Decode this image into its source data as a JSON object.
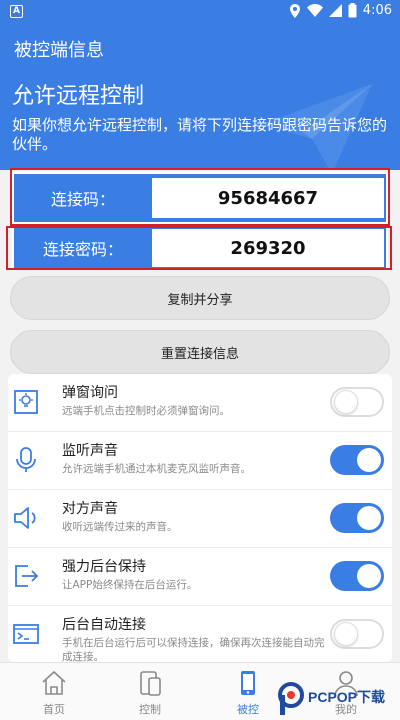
{
  "status_bar": {
    "time": "4:06",
    "left_icon": "A"
  },
  "header": {
    "title": "被控端信息",
    "heading": "允许远程控制",
    "description": "如果你想允许远程控制，请将下列连接码跟密码告诉您的伙伴。"
  },
  "connection": {
    "code_label": "连接码：",
    "code_value": "95684667",
    "password_label": "连接密码：",
    "password_value": "269320"
  },
  "buttons": {
    "copy_share": "复制并分享",
    "reset": "重置连接信息"
  },
  "settings": [
    {
      "title": "弹窗询问",
      "desc": "远端手机点击控制时必须弹窗询问。",
      "on": false,
      "icon": "lamp-icon"
    },
    {
      "title": "监听声音",
      "desc": "允许远端手机通过本机麦克风监听声音。",
      "on": true,
      "icon": "microphone-icon"
    },
    {
      "title": "对方声音",
      "desc": "收听远端传过来的声音。",
      "on": true,
      "icon": "speaker-icon"
    },
    {
      "title": "强力后台保持",
      "desc": "让APP始终保持在后台运行。",
      "on": true,
      "icon": "export-icon"
    },
    {
      "title": "后台自动连接",
      "desc": "手机在后台运行后可以保持连接，确保再次连接能自动完成连接。",
      "on": false,
      "icon": "terminal-icon"
    }
  ],
  "tabs": [
    {
      "label": "首页",
      "icon": "home-icon"
    },
    {
      "label": "控制",
      "icon": "devices-icon"
    },
    {
      "label": "被控",
      "icon": "phone-icon",
      "active": true
    },
    {
      "label": "我的",
      "icon": "person-icon"
    }
  ],
  "watermark": {
    "text": "PCPOP下载"
  },
  "colors": {
    "primary": "#3a7ee4",
    "highlight_box": "#d32029"
  }
}
